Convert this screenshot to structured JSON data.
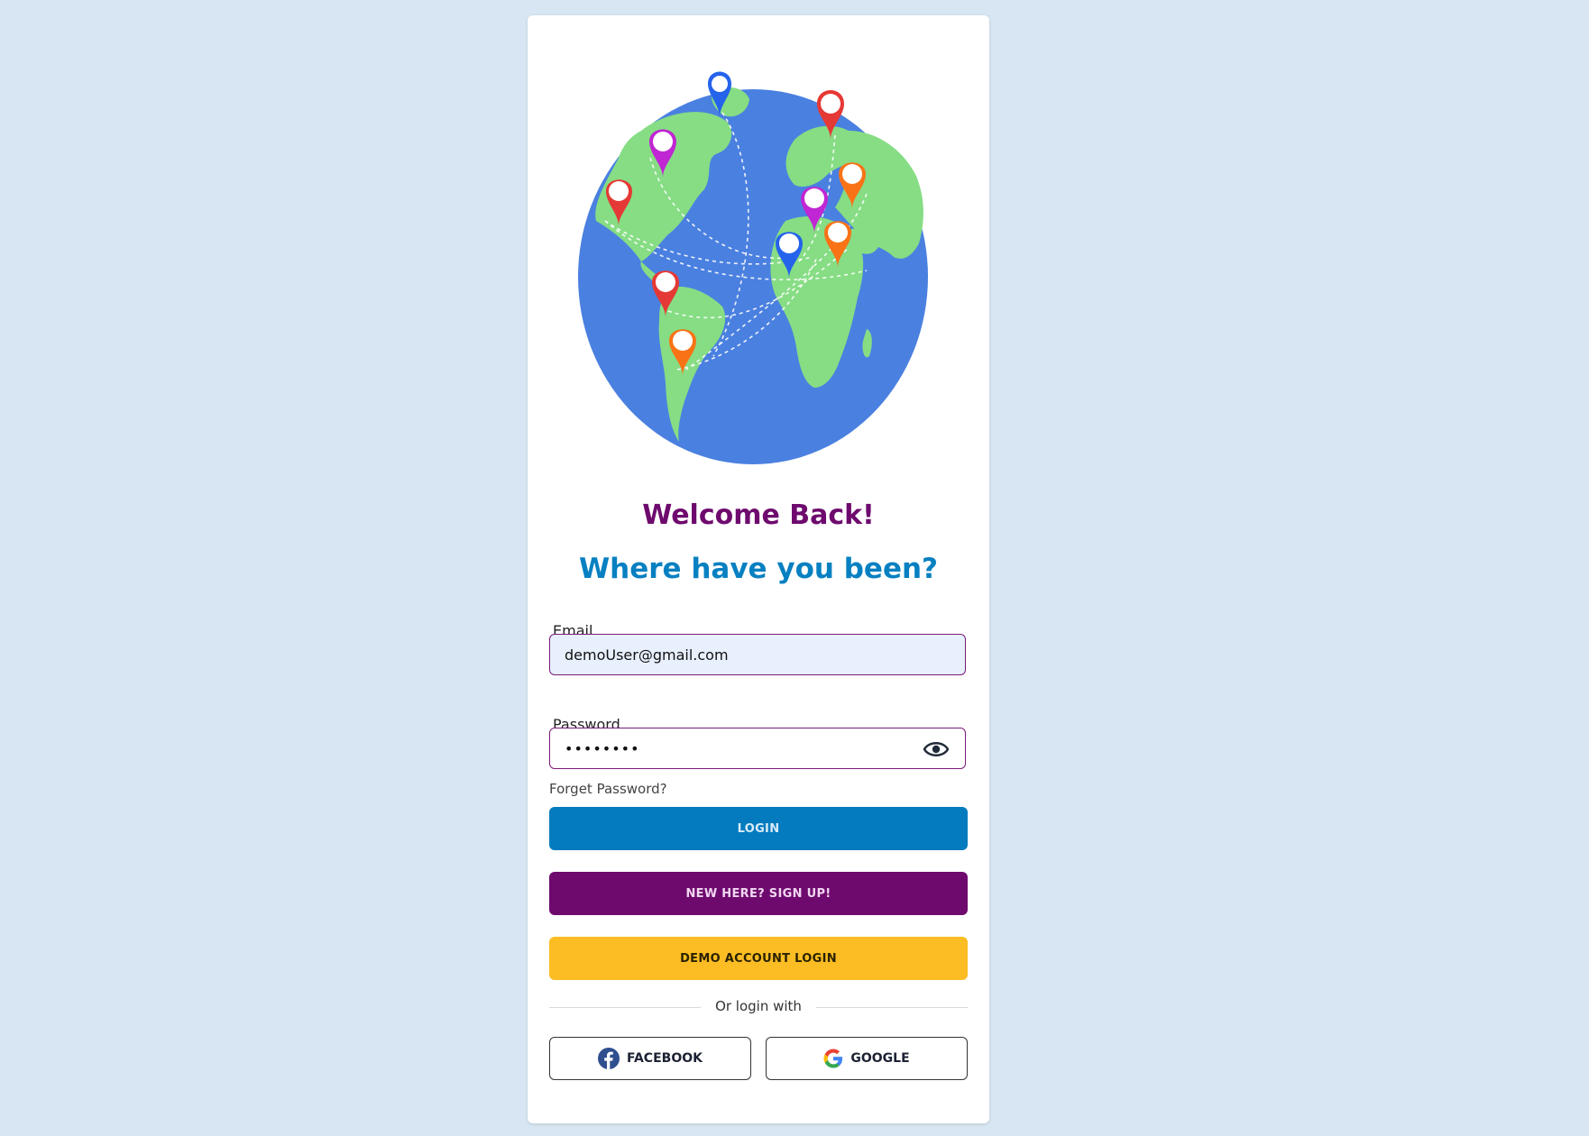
{
  "heading": {
    "welcome": "Welcome Back!",
    "subtitle": "Where have you been?"
  },
  "form": {
    "email_label": "Email",
    "email_value": "demoUser@gmail.com",
    "password_label": "Password",
    "password_value": "demopass",
    "forget_password": "Forget Password?"
  },
  "buttons": {
    "login": "LOGIN",
    "signup": "NEW HERE? SIGN UP!",
    "demo": "DEMO ACCOUNT LOGIN"
  },
  "social": {
    "divider": "Or login with",
    "facebook": "FACEBOOK",
    "google": "GOOGLE"
  },
  "colors": {
    "page_background": "#d8e6f3",
    "welcome_text": "#6e0a6e",
    "subtitle_text": "#0780c1",
    "login_button": "#047bbf",
    "signup_button": "#6e0a6e",
    "demo_button": "#fbbd23",
    "globe_ocean": "#4a80e0",
    "globe_land": "#86dd84"
  },
  "illustration": {
    "icon": "globe-with-map-pins"
  }
}
